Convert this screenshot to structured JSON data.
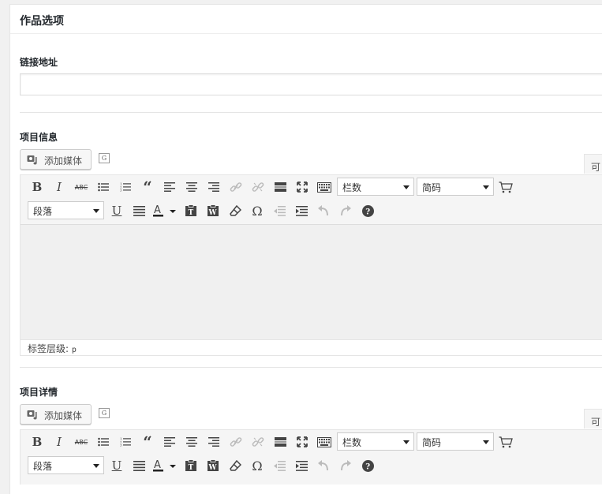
{
  "panel": {
    "title": "作品选项"
  },
  "link": {
    "label": "链接地址",
    "value": "",
    "placeholder": ""
  },
  "editors": [
    {
      "label": "项目信息",
      "add_media": "添加媒体",
      "g_icon": "G",
      "tab_stub": "可",
      "toolbar": {
        "row1": [
          "bold-icon",
          "italic-icon",
          "strikethrough-icon",
          "bullet-list-icon",
          "numbered-list-icon",
          "blockquote-icon",
          "align-left-icon",
          "align-center-icon",
          "align-right-icon",
          "link-icon",
          "unlink-icon",
          "more-tag-icon",
          "fullscreen-icon",
          "keyboard-icon"
        ],
        "columns_select": "栏数",
        "shortcode_select": "简码",
        "row2": [
          "underline-icon",
          "justify-icon",
          "text-color-icon",
          "paste-text-icon",
          "paste-word-icon",
          "clear-format-icon",
          "special-char-icon",
          "outdent-icon",
          "indent-icon",
          "undo-icon",
          "redo-icon",
          "help-icon"
        ],
        "format_select": "段落"
      },
      "status": {
        "label": "标签层级:",
        "tag": "p"
      }
    },
    {
      "label": "项目详情",
      "add_media": "添加媒体",
      "g_icon": "G",
      "tab_stub": "可",
      "toolbar": {
        "columns_select": "栏数",
        "shortcode_select": "简码",
        "format_select": "段落"
      }
    }
  ]
}
